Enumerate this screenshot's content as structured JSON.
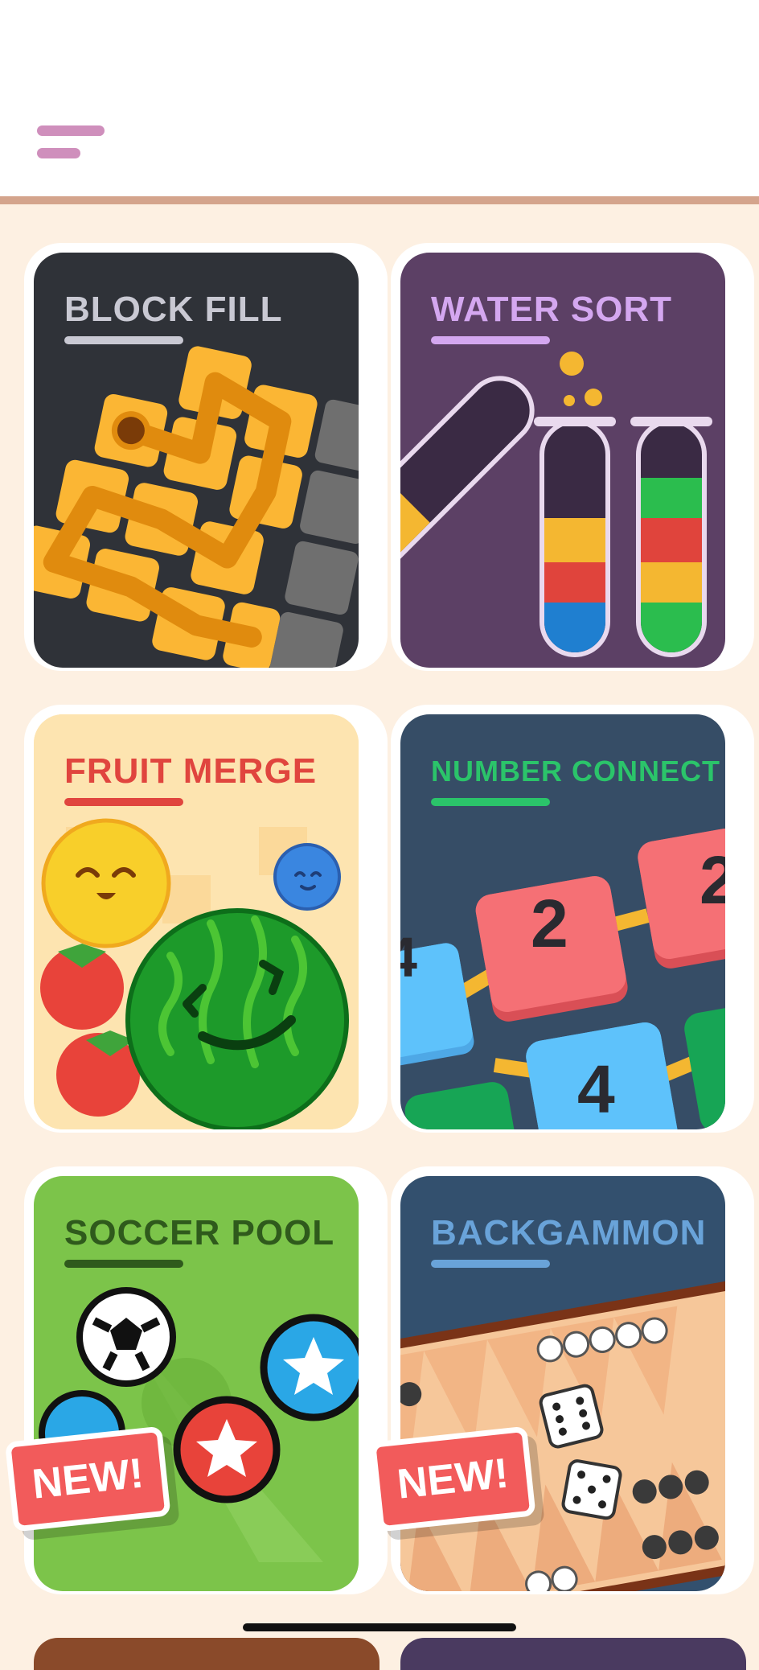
{
  "header": {
    "menu_icon": "hamburger-menu-icon"
  },
  "games": [
    {
      "title": "BLOCK FILL",
      "title_color": "#c9c9d3",
      "bg": "#2f3238",
      "new": false
    },
    {
      "title": "WATER SORT",
      "title_color": "#d4a7f0",
      "bg": "#5c4065",
      "new": false
    },
    {
      "title": "FRUIT MERGE",
      "title_color": "#e0453e",
      "bg": "#fde4b0",
      "new": false
    },
    {
      "title": "NUMBER CONNECT",
      "title_color": "#2bc46a",
      "bg": "#364d66",
      "new": false
    },
    {
      "title": "SOCCER POOL",
      "title_color": "#2f5a1c",
      "bg": "#7cc44a",
      "new": true
    },
    {
      "title": "BACKGAMMON",
      "title_color": "#69a3d9",
      "bg": "#33506e",
      "new": true
    }
  ],
  "badge": {
    "label": "NEW!"
  },
  "number_tiles": [
    "2",
    "2",
    "4",
    "4"
  ],
  "colors": {
    "accent": "#cf8fbc",
    "background": "#fdf0e2",
    "rule": "#d4a48c"
  }
}
